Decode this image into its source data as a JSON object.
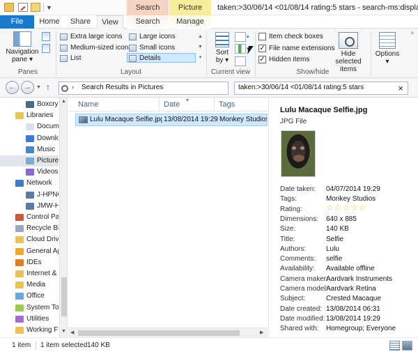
{
  "titlebar": {
    "context_search": "Search Tools",
    "context_picture": "Picture Tools",
    "window_title": "taken:>30/06/14 <01/08/14 rating:5 stars - search-ms:displayname=Search"
  },
  "tabs": {
    "file": "File",
    "home": "Home",
    "share": "Share",
    "view": "View",
    "search": "Search",
    "manage": "Manage"
  },
  "ribbon": {
    "panes": {
      "navigation_pane_line1": "Navigation",
      "navigation_pane_line2": "pane",
      "group_label": "Panes"
    },
    "layout": {
      "extra_large_icons": "Extra large icons",
      "large_icons": "Large icons",
      "medium_icons": "Medium-sized icons",
      "small_icons": "Small icons",
      "list": "List",
      "details": "Details",
      "group_label": "Layout"
    },
    "current_view": {
      "sort_by_line1": "Sort",
      "sort_by_line2": "by",
      "group_label": "Current view"
    },
    "show_hide": {
      "item_checkboxes": "Item check boxes",
      "file_name_extensions": "File name extensions",
      "hidden_items": "Hidden items",
      "hide_selected_line1": "Hide selected",
      "hide_selected_line2": "items",
      "group_label": "Show/hide",
      "item_checkboxes_checked": false,
      "file_name_extensions_checked": true,
      "hidden_items_checked": true
    },
    "options": "Options"
  },
  "address": {
    "path": "Search Results in Pictures",
    "search_query": "taken:>30/06/14 <01/08/14 rating:5 stars"
  },
  "nav": {
    "items": [
      {
        "label": "Boxcryptor",
        "icon": "drive-icon"
      },
      {
        "label": "Libraries",
        "icon": "libraries-icon"
      },
      {
        "label": "Documents",
        "icon": "documents-icon"
      },
      {
        "label": "Downloads",
        "icon": "downloads-icon"
      },
      {
        "label": "Music",
        "icon": "music-icon"
      },
      {
        "label": "Pictures",
        "icon": "pictures-icon",
        "selected": true
      },
      {
        "label": "Videos",
        "icon": "videos-icon"
      },
      {
        "label": "Network",
        "icon": "network-icon"
      },
      {
        "label": "J-HPNC",
        "icon": "computer-icon"
      },
      {
        "label": "JMW-HP",
        "icon": "computer-icon"
      },
      {
        "label": "Control Panel",
        "icon": "control-panel-icon"
      },
      {
        "label": "Recycle Bin",
        "icon": "recycle-bin-icon"
      },
      {
        "label": "Cloud Drives",
        "icon": "folder-icon"
      },
      {
        "label": "General Apps",
        "icon": "folder-icon"
      },
      {
        "label": "IDEs",
        "icon": "folder-icon"
      },
      {
        "label": "Internet & Network",
        "icon": "folder-icon"
      },
      {
        "label": "Media",
        "icon": "folder-icon"
      },
      {
        "label": "Office",
        "icon": "folder-icon"
      },
      {
        "label": "System Tools",
        "icon": "folder-icon"
      },
      {
        "label": "Utilities",
        "icon": "folder-icon"
      },
      {
        "label": "Working Files",
        "icon": "folder-icon"
      }
    ]
  },
  "filelist": {
    "columns": {
      "name": "Name",
      "date": "Date",
      "tags": "Tags"
    },
    "rows": [
      {
        "name": "Lulu Macaque Selfie.jpg",
        "date": "13/08/2014 19:29",
        "tags": "Monkey Studios"
      }
    ]
  },
  "details": {
    "title": "Lulu Macaque Selfie.jpg",
    "type": "JPG File",
    "rating_stars": 5,
    "props": [
      {
        "label": "Date taken:",
        "value": "04/07/2014 19:29"
      },
      {
        "label": "Tags:",
        "value": "Monkey Studios"
      },
      {
        "label": "Rating:",
        "value": ""
      },
      {
        "label": "Dimensions:",
        "value": "640 x 885"
      },
      {
        "label": "Size:",
        "value": "140 KB"
      },
      {
        "label": "Title:",
        "value": "Selfie"
      },
      {
        "label": "Authors:",
        "value": "Lulu"
      },
      {
        "label": "Comments:",
        "value": "selfie"
      },
      {
        "label": "Availability:",
        "value": "Available offline"
      },
      {
        "label": "Camera maker:",
        "value": "Aardvark Instruments"
      },
      {
        "label": "Camera model:",
        "value": "Aardvark Retina"
      },
      {
        "label": "Subject:",
        "value": "Crested Macaque"
      },
      {
        "label": "Date created:",
        "value": "13/08/2014 06:31"
      },
      {
        "label": "Date modified:",
        "value": "13/08/2014 19:29"
      },
      {
        "label": "Shared with:",
        "value": "Homegroup; Everyone"
      }
    ]
  },
  "status": {
    "count": "1 item",
    "selected": "1 item selected",
    "size": "140 KB"
  },
  "colors": {
    "file_tab": "#1979ca",
    "selection": "#cde8ff",
    "search_tools": "#f7d3c2",
    "picture_tools": "#f8ed9c",
    "star": "#f2c23e"
  }
}
